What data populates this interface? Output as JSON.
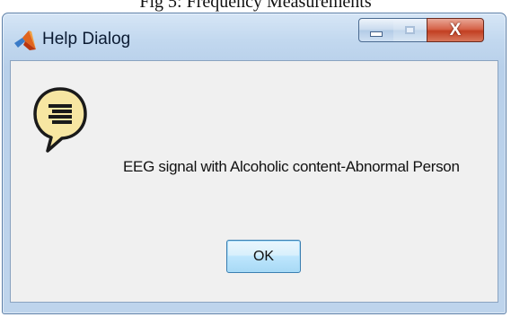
{
  "caption": "Fig 5: Frequency Measurements",
  "window": {
    "title": "Help Dialog",
    "icon": "matlab-logo-icon",
    "controls": {
      "minimize": "minimize-icon",
      "maximize": "maximize-icon",
      "close_label": "X"
    }
  },
  "dialog": {
    "icon": "help-speech-bubble-icon",
    "message": "EEG signal with Alcoholic content-Abnormal Person",
    "ok_label": "OK"
  },
  "colors": {
    "close_button": "#c84a2f",
    "help_icon_fill": "#f7e6a2",
    "ok_button_border": "#3c7fb1"
  }
}
